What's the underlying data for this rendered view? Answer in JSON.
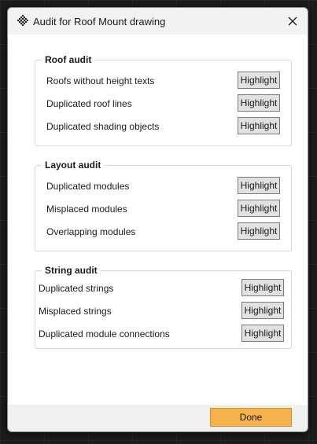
{
  "dialog": {
    "title": "Audit for Roof Mount drawing",
    "icon": "app-logo-icon",
    "close_icon": "close-icon"
  },
  "groups": [
    {
      "title": "Roof audit",
      "items": [
        {
          "label": "Roofs without height texts",
          "button": "Highlight"
        },
        {
          "label": "Duplicated roof lines",
          "button": "Highlight"
        },
        {
          "label": "Duplicated shading objects",
          "button": "Highlight"
        }
      ]
    },
    {
      "title": "Layout audit",
      "items": [
        {
          "label": "Duplicated modules",
          "button": "Highlight"
        },
        {
          "label": "Misplaced modules",
          "button": "Highlight"
        },
        {
          "label": "Overlapping modules",
          "button": "Highlight"
        }
      ]
    },
    {
      "title": "String audit",
      "items": [
        {
          "label": "Duplicated strings",
          "button": "Highlight"
        },
        {
          "label": "Misplaced strings",
          "button": "Highlight"
        },
        {
          "label": "Duplicated module connections",
          "button": "Highlight"
        }
      ]
    }
  ],
  "footer": {
    "done_label": "Done"
  },
  "colors": {
    "accent": "#f5b24b",
    "background": "#1c1c1c",
    "dialog": "#f2f2f2"
  }
}
